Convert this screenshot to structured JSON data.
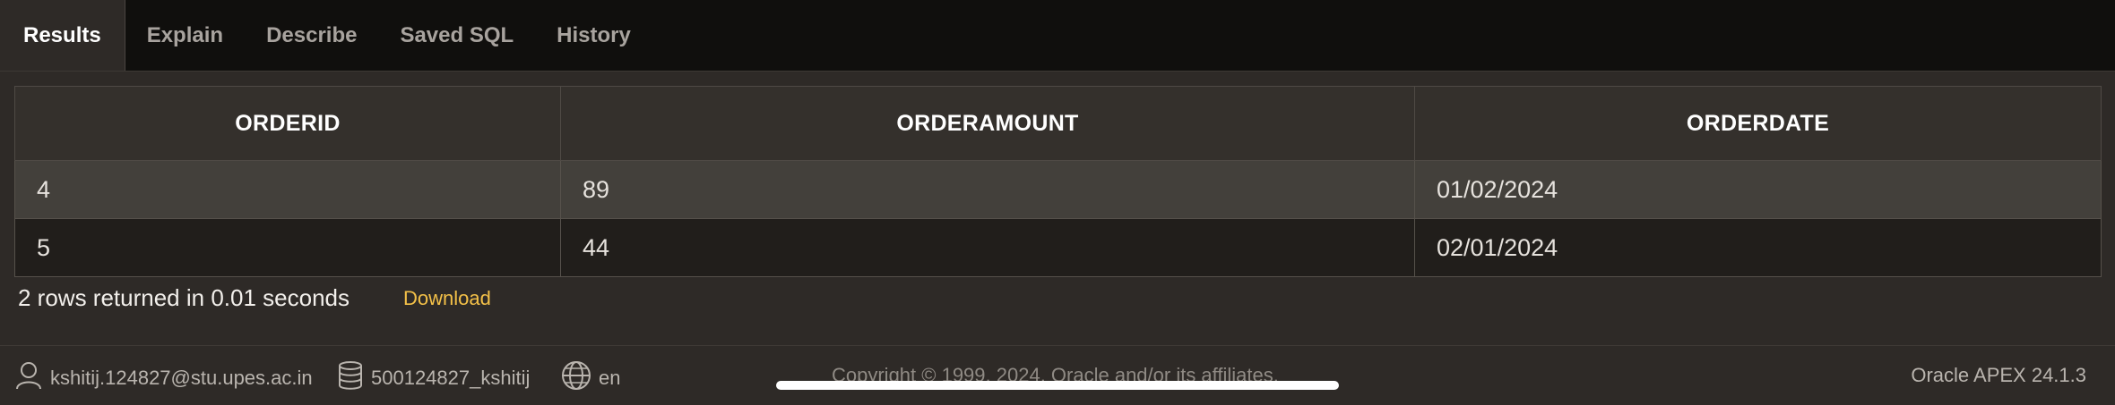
{
  "tabs": [
    {
      "label": "Results",
      "active": true
    },
    {
      "label": "Explain"
    },
    {
      "label": "Describe"
    },
    {
      "label": "Saved SQL"
    },
    {
      "label": "History"
    }
  ],
  "table": {
    "columns": [
      "ORDERID",
      "ORDERAMOUNT",
      "ORDERDATE"
    ],
    "rows": [
      [
        "4",
        "89",
        "01/02/2024"
      ],
      [
        "5",
        "44",
        "02/01/2024"
      ]
    ]
  },
  "status": {
    "text": "2 rows returned in 0.01 seconds",
    "download_label": "Download"
  },
  "footer": {
    "user": "kshitij.124827@stu.upes.ac.in",
    "schema": "500124827_kshitij",
    "language": "en",
    "copyright": "Copyright © 1999, 2024, Oracle and/or its affiliates.",
    "version": "Oracle APEX 24.1.3"
  },
  "colors": {
    "accent_link": "#f3c048",
    "tabbar_bg": "#100f0d",
    "page_bg": "#2e2a27"
  }
}
